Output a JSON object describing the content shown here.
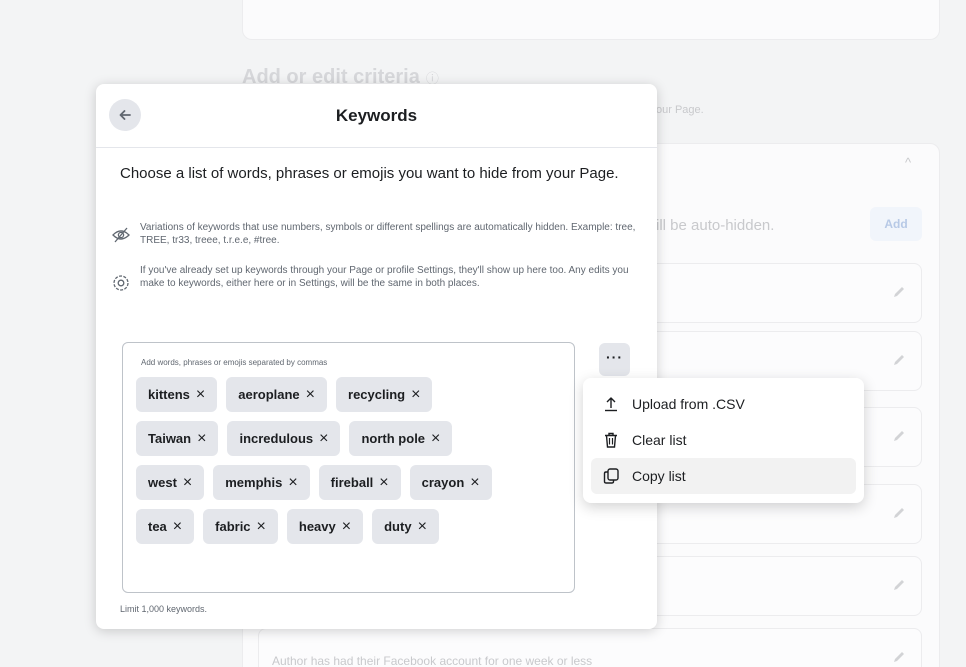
{
  "background": {
    "heading": "Add or edit criteria",
    "heading_icon": "ⓘ",
    "subtext": "our Page.",
    "auto_hidden_text": "ill be auto-hidden.",
    "add_label": "Add",
    "footer_text": "Author has had their Facebook account for one week or less"
  },
  "dialog": {
    "title": "Keywords",
    "intro": "Choose a list of words, phrases or emojis you want to hide from your Page.",
    "info1": "Variations of keywords that use numbers, symbols or different spellings are automatically hidden. Example: tree, TREE, tr33, treee, t.r.e.e, #tree.",
    "info2": "If you've already set up keywords through your Page or profile Settings, they'll show up here too. Any edits you make to keywords, either here or in Settings, will be the same in both places.",
    "placeholder": "Add words, phrases or emojis separated by commas",
    "keywords": [
      [
        "kittens",
        "aeroplane",
        "recycling"
      ],
      [
        "Taiwan",
        "incredulous",
        "north pole"
      ],
      [
        "west",
        "memphis",
        "fireball",
        "crayon"
      ],
      [
        "tea",
        "fabric",
        "heavy",
        "duty"
      ]
    ],
    "remove_glyph": "×",
    "limit": "Limit 1,000 keywords.",
    "more_label": "···"
  },
  "menu": {
    "items": [
      {
        "label": "Upload from .CSV",
        "icon": "upload-icon"
      },
      {
        "label": "Clear list",
        "icon": "trash-icon"
      },
      {
        "label": "Copy list",
        "icon": "copy-icon"
      }
    ]
  }
}
